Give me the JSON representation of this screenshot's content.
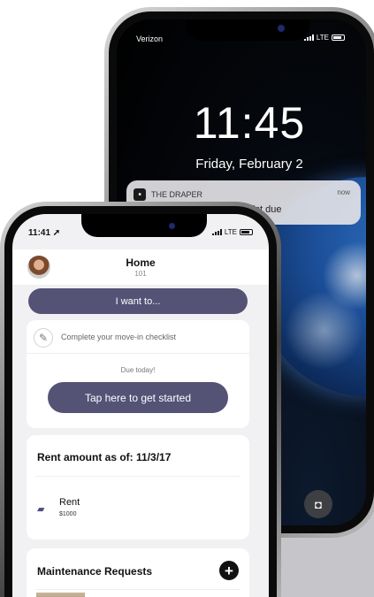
{
  "lock_screen": {
    "carrier": "Verizon",
    "network": "LTE",
    "time": "11:45",
    "date": "Friday, February 2",
    "notification": {
      "app_name": "THE DRAPER",
      "time": "now",
      "text": "Complete 1 Move-in Checklist due"
    }
  },
  "app": {
    "status_bar": {
      "time": "11:41 ➚",
      "network": "LTE"
    },
    "header": {
      "title": "Home",
      "subtitle": "101"
    },
    "actions": {
      "i_want_label": "I want to..."
    },
    "checklist_card": {
      "item_label": "Complete your move-in checklist",
      "due_text": "Due today!",
      "cta_label": "Tap here to get started"
    },
    "rent_card": {
      "title": "Rent amount as of: 11/3/17",
      "item_label": "Rent",
      "item_amount": "$1000"
    },
    "maintenance_card": {
      "title": "Maintenance Requests",
      "add_icon": "+"
    }
  },
  "icons": {
    "checklist": "pencil-icon",
    "rent": "money-icon",
    "add": "plus-circle-icon",
    "camera": "camera-icon"
  },
  "colors": {
    "accent": "#545376",
    "background": "#f1f1f3",
    "floor": "#c6c6ca"
  }
}
